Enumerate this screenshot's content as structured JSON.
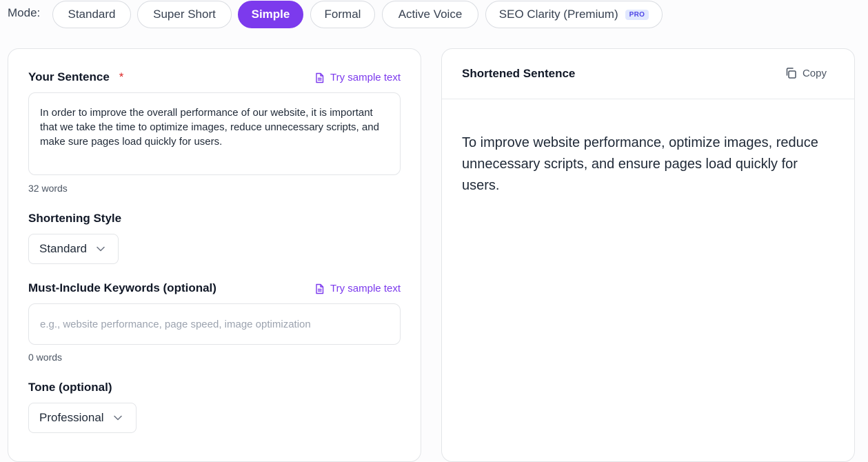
{
  "mode": {
    "label": "Mode:",
    "options": [
      "Standard",
      "Super Short",
      "Simple",
      "Formal",
      "Active Voice",
      "SEO Clarity (Premium)"
    ],
    "active": "Simple",
    "pro_badge": "PRO"
  },
  "input": {
    "sentence_label": "Your Sentence",
    "required_mark": "*",
    "try_sample": "Try sample text",
    "sentence_text": "In order to improve the overall performance of our website, it is important that we take the time to optimize images, reduce unnecessary scripts, and make sure pages load quickly for users.",
    "sentence_word_count": "32 words",
    "style_label": "Shortening Style",
    "style_value": "Standard",
    "keywords_label": "Must-Include Keywords (optional)",
    "keywords_try_sample": "Try sample text",
    "keywords_placeholder": "e.g., website performance, page speed, image optimization",
    "keywords_word_count": "0 words",
    "tone_label": "Tone (optional)",
    "tone_value": "Professional"
  },
  "output": {
    "title": "Shortened Sentence",
    "copy_label": "Copy",
    "text": "To improve website performance, optimize images, reduce unnecessary scripts, and ensure pages load quickly for users."
  },
  "colors": {
    "accent": "#7c3aed",
    "required": "#dc2626",
    "pro_badge_bg": "#e0e7ff"
  },
  "icons": {
    "sample": "document-icon",
    "chevron": "chevron-down-icon",
    "copy": "copy-icon"
  }
}
